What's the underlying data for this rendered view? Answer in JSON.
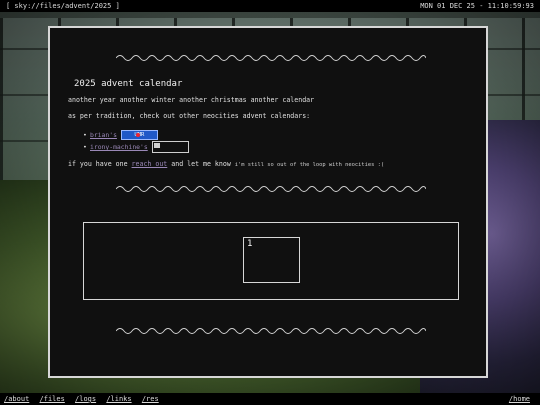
{
  "topbar": {
    "path": "[ sky://files/advent/2025 ]",
    "clock": "MON 01 DEC 25 - 11:10:59:93"
  },
  "content": {
    "title": "2025 advent calendar",
    "line1": "another year another winter another christmas another calendar",
    "line2": "as per tradition, check out other neocities advent calendars:",
    "links": [
      {
        "label": "brian's",
        "badge": "UMR"
      },
      {
        "label": "irony-machine's"
      }
    ],
    "reach": {
      "before": "if you have one",
      "link": "reach out",
      "after": "and let me know",
      "note": "i'm still so out of the loop with neocities :("
    }
  },
  "calendar": {
    "days": [
      "1"
    ]
  },
  "nav": {
    "left": [
      "/about",
      "/files",
      "/logs",
      "/links",
      "/res"
    ],
    "right": "/home"
  }
}
